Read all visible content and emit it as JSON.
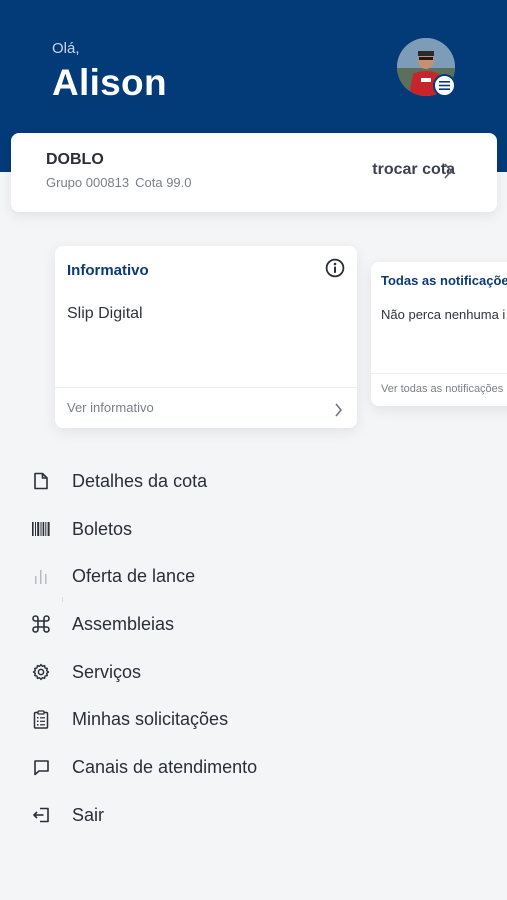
{
  "header": {
    "greeting": "Olá,",
    "username": "Alison",
    "avatar_icon": "user-avatar-photo",
    "badge_icon": "menu-lines-icon",
    "background_color": "#033a78"
  },
  "cota_card": {
    "name": "DOBLO",
    "group_label": "Grupo 000813",
    "cota_label": "Cota 99.0",
    "switch_label": "trocar cota",
    "switch_icon": "chevron-right-icon"
  },
  "info_card": {
    "title": "Informativo",
    "title_icon": "info-circle-icon",
    "body": "Slip Digital",
    "link": "Ver informativo",
    "link_icon": "chevron-right-icon"
  },
  "notifications_card": {
    "title": "Todas as notificações",
    "body": "Não perca nenhuma i",
    "link": "Ver todas as notificações"
  },
  "menu": {
    "items": [
      {
        "label": "Detalhes da cota",
        "icon": "document-icon"
      },
      {
        "label": "Boletos",
        "icon": "barcode-icon"
      },
      {
        "label": "Oferta de lance",
        "icon": "bar-chart-icon"
      },
      {
        "label": "Assembleias",
        "icon": "command-icon"
      },
      {
        "label": "Serviços",
        "icon": "gear-icon"
      },
      {
        "label": "Minhas solicitações",
        "icon": "clipboard-icon"
      },
      {
        "label": "Canais de atendimento",
        "icon": "chat-bubble-icon"
      },
      {
        "label": "Sair",
        "icon": "logout-icon"
      }
    ]
  }
}
